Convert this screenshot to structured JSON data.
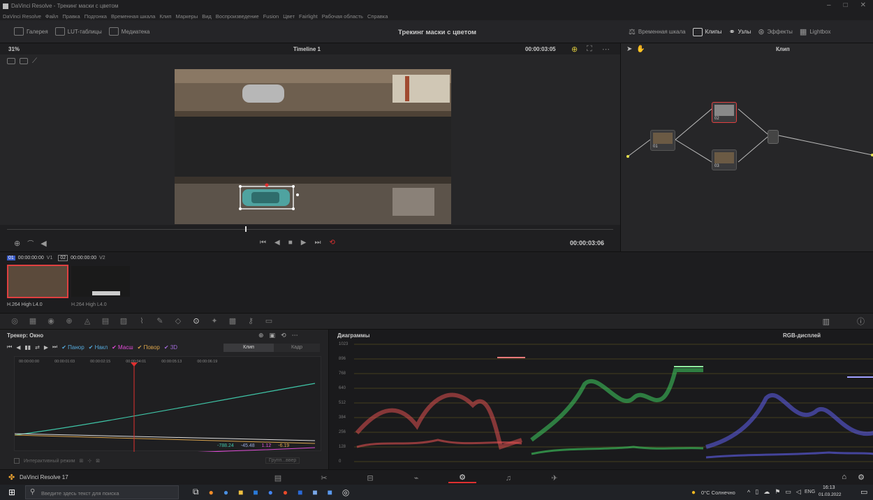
{
  "window": {
    "title": "DaVinci Resolve - Трекинг маски с цветом",
    "controls": [
      "–",
      "□",
      "✕"
    ]
  },
  "menu": [
    "DaVinci Resolve",
    "Файл",
    "Правка",
    "Подгонка",
    "Временная шкала",
    "Клип",
    "Маркеры",
    "Вид",
    "Воспроизведение",
    "Fusion",
    "Цвет",
    "Fairlight",
    "Рабочая область",
    "Справка"
  ],
  "toolbar": {
    "left": [
      "Галерея",
      "LUT-таблицы",
      "Медиатека"
    ],
    "project_title": "Трекинг маски с цветом",
    "right": [
      "Временная шкала",
      "Клипы",
      "Узлы",
      "Эффекты",
      "Lightbox"
    ]
  },
  "viewer": {
    "zoom": "31%",
    "timeline": "Timeline 1",
    "timecode_top": "00:00:03:05",
    "timecode_bottom": "00:00:03:06"
  },
  "nodes_panel": {
    "mode": "Клип",
    "nodes": [
      {
        "id": "01",
        "label": "01"
      },
      {
        "id": "02",
        "label": "02"
      },
      {
        "id": "03",
        "label": "03"
      }
    ]
  },
  "clips": [
    {
      "index": "01",
      "tc": "00:00:00:00",
      "track": "V1",
      "codec": "H.264 High L4.0"
    },
    {
      "index": "02",
      "tc": "00:00:00:00",
      "track": "V2",
      "codec": "H.264 High L4.0"
    }
  ],
  "tracker": {
    "title": "Трекер: Окно",
    "checks": [
      "Панор",
      "Накл",
      "Масш",
      "Повор",
      "3D"
    ],
    "modes": [
      "Клип",
      "Кадр"
    ],
    "ruler": [
      "00:00:00:00",
      "00:00:01:03",
      "00:00:02:15",
      "00:00:04:01",
      "00:00:05:13",
      "00:00:06:19"
    ],
    "values": [
      "-788.24",
      "-45.48",
      "1.12",
      "-6.19"
    ],
    "interactive_label": "Интерактивный режим",
    "dropdown": "Групп...ввер",
    "colors": {
      "green": "#3fc6a8",
      "white": "#dddddd",
      "pink": "#e04dd8",
      "orange": "#d8a24a",
      "playhead": "#e03030"
    }
  },
  "scopes": {
    "title": "Диаграммы",
    "mode": "RGB-дисплей",
    "scale": [
      "1023",
      "896",
      "768",
      "640",
      "512",
      "384",
      "256",
      "128",
      "0"
    ]
  },
  "app_name": "DaVinci Resolve 17",
  "taskbar": {
    "search": "Введите здесь текст для поиска",
    "weather": "0°C Солнечно",
    "lang": "ENG",
    "time": "16:13",
    "date": "01.03.2022"
  }
}
